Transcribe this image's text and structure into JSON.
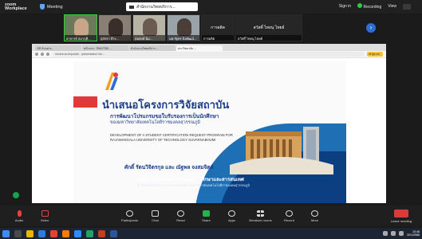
{
  "meeting": {
    "brand": "zoom Workplace",
    "meeting_label": "Meeting",
    "window_title": "สำนักงานวิทยบริการ...",
    "sign_in": "Sign in",
    "recording": "Recording",
    "view": "View"
  },
  "participants": [
    {
      "name": "อาจารย์ สมาฤดี..."
    },
    {
      "name": "สุภัสรา ธีระ..."
    },
    {
      "name": "สมพงษ์ ฉิม..."
    },
    {
      "name": "นพ.รัฐพร นิลพัฒน์..."
    },
    {
      "name": "การผลิต",
      "sub": "การผลิต"
    },
    {
      "name": "สวัสดิ์ ไทยนุ ไทยย์",
      "sub": "สวัสดิ์ ไทยนุ ไทยย์"
    }
  ],
  "browser": {
    "tabs": [
      "GR ตัวอย่าง...",
      "หน้าแรก · RMUTSB ...",
      "สำนักงานวิทยบริการ ...",
      "มหาวิทยาลัย ..."
    ],
    "url": "rmutsb.ac.th/portal/.../presentation?id=...",
    "ext_label": "เข้าสู่ระบบ"
  },
  "slide": {
    "title": "นำเสนอโครงการวิจัยสถาบัน",
    "subtitle1": "การพัฒนาโปรแกรมขอใบรับรองการเป็นนักศึกษา",
    "subtitle2": "ของมหาวิทยาลัยเทคโนโลยีราชมงคลสุวรรณภูมิ",
    "english": "DEVELOPMENT OF A STUDENT CERTIFICATION REQUEST PROGRAM FOR RAJAMANGALA UNIVERSITY OF TECHNOLOGY SUVARNABHUMI",
    "authors": "ศักดิ์ รัตนวิจิตรกุล และ ณัฐพล จงสมจิตต์",
    "department": "งานตรวจสอบและรับรองผลการศึกษาและสารสนเทศ",
    "department_sub": "สำนักส่งเสริมวิชาการและงานทะเบียน มหาวิทยาลัยเทคโนโลยีราชมงคลสุวรรณภูมิ"
  },
  "toolbar": {
    "audio": "Audio",
    "video": "Video",
    "participants": "Participants",
    "chat": "Chat",
    "react": "React",
    "share": "Share",
    "apps": "Apps",
    "breakout": "Breakout rooms",
    "record": "Record",
    "more": "More",
    "leave": "Leave meeting"
  },
  "taskbar": {
    "time": "15:48",
    "date": "30/1/2568"
  },
  "colors": {
    "accent": "#2b6ed6",
    "active_speaker": "#2fcf3a",
    "slide_blue": "#1b3d8c",
    "leave": "#d93a3a"
  }
}
